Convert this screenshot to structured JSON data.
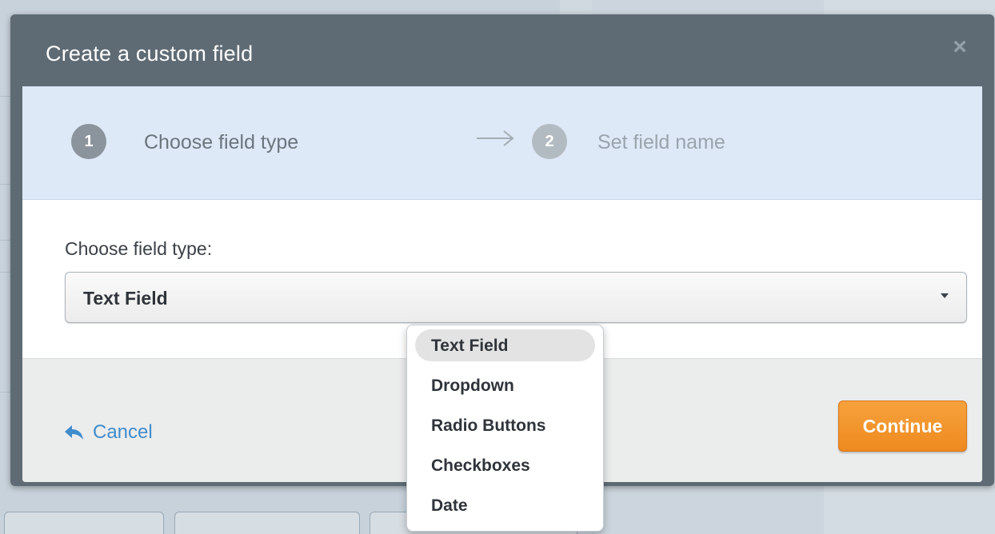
{
  "modal": {
    "title": "Create a custom field",
    "close_glyph": "×",
    "steps": [
      {
        "number": "1",
        "label": "Choose field type",
        "state": "active"
      },
      {
        "number": "2",
        "label": "Set field name",
        "state": "inactive"
      }
    ],
    "field_label": "Choose field type:",
    "field_type": {
      "selected": "Text Field",
      "options": [
        "Text Field",
        "Dropdown",
        "Radio Buttons",
        "Checkboxes",
        "Date"
      ]
    },
    "footer": {
      "cancel_label": "Cancel",
      "continue_label": "Continue"
    }
  },
  "colors": {
    "header_bg": "#5f6b74",
    "steps_bg": "#dee9f7",
    "accent_orange": "#f09124",
    "link_blue": "#3f8ccc"
  },
  "icons": {
    "close": "close-icon",
    "step_arrow": "arrow-right-icon",
    "cancel": "reply-icon",
    "select_caret": "caret-down-icon"
  }
}
